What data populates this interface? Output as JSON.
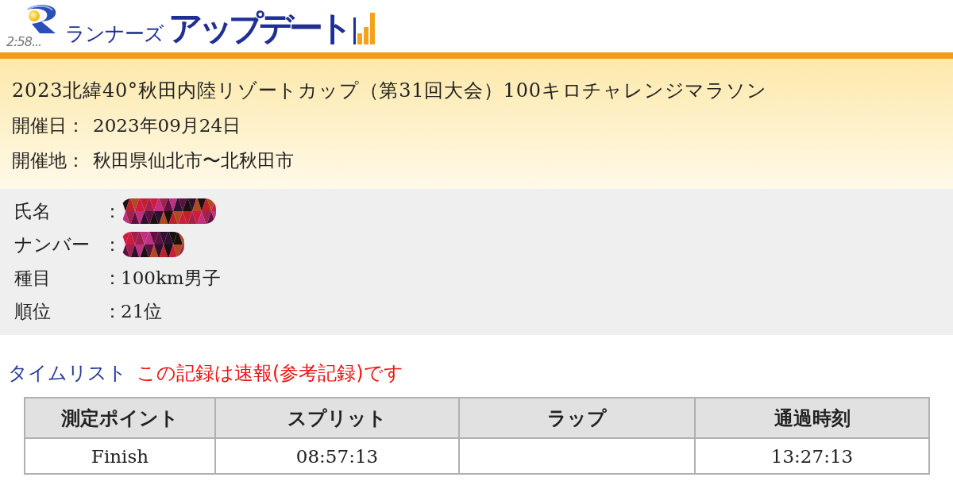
{
  "header": {
    "logo": {
      "clock": "2:58...",
      "brand_small": "ランナーズ",
      "brand_large": "アップデート"
    }
  },
  "event": {
    "title": "2023北緯40°秋田内陸リゾートカップ（第31回大会）100キロチャレンジマラソン",
    "details": [
      {
        "label": "開催日：",
        "value": "2023年09月24日"
      },
      {
        "label": "開催地：",
        "value": "秋田県仙北市〜北秋田市"
      }
    ]
  },
  "runner": [
    {
      "label": "氏名",
      "separator": "：",
      "redacted": true
    },
    {
      "label": "ナンバー",
      "separator": "：",
      "redacted": true
    },
    {
      "label": "種目",
      "separator": "：",
      "redacted": false,
      "value": "100km男子"
    },
    {
      "label": "順位",
      "separator": "：",
      "redacted": false,
      "value": "21位"
    }
  ],
  "time_list": {
    "title": "タイムリスト",
    "notice": "この記録は速報(参考記録)です"
  },
  "time_table": {
    "columns": [
      "測定ポイント",
      "スプリット",
      "ラップ",
      "通過時刻"
    ],
    "rows": [
      [
        "Finish",
        "08:57:13",
        null,
        "13:27:13"
      ]
    ]
  }
}
